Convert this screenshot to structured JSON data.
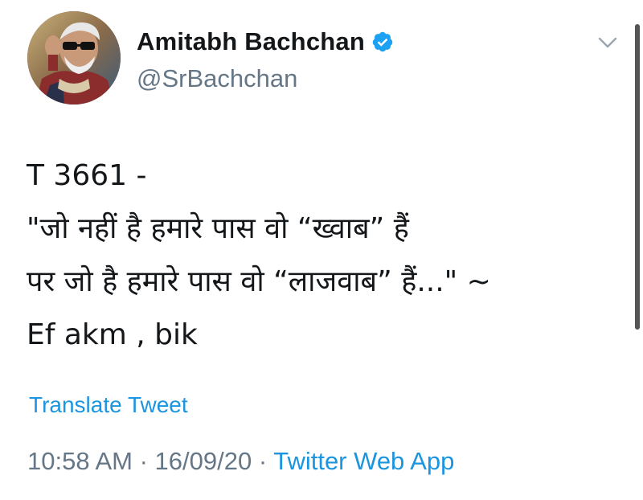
{
  "author": {
    "display_name": "Amitabh Bachchan",
    "handle": "@SrBachchan",
    "verified": true,
    "verified_color": "#1da1f2",
    "avatar_icon": "profile-photo"
  },
  "menu": {
    "icon": "chevron-down-icon"
  },
  "tweet": {
    "lines": [
      "T 3661 -",
      "\"जो नहीं है हमारे पास वो “ख्वाब” हैं",
      "पर जो है हमारे पास वो “लाजवाब” हैं...\" ~",
      "Ef akm , bik"
    ]
  },
  "translate": {
    "label": "Translate Tweet"
  },
  "meta": {
    "time": "10:58 AM",
    "separator": " · ",
    "date": "16/09/20",
    "source": "Twitter Web App"
  },
  "colors": {
    "link": "#1b95e0",
    "secondary_text": "#657786",
    "primary_text": "#14171a"
  }
}
